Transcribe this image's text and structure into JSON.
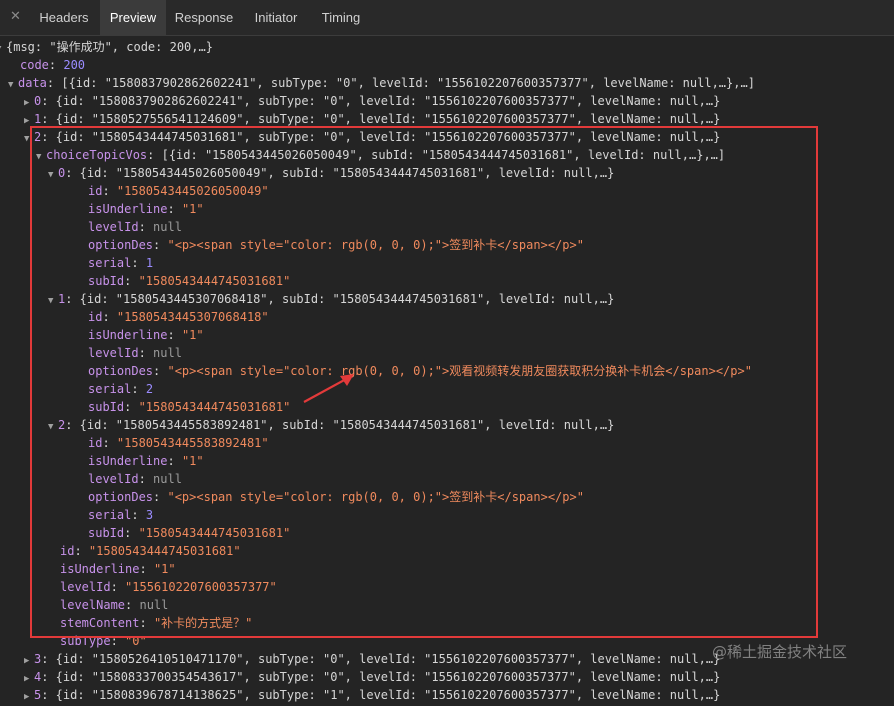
{
  "tabs": {
    "close": "✕",
    "headers": "Headers",
    "preview": "Preview",
    "response": "Response",
    "initiator": "Initiator",
    "timing": "Timing"
  },
  "rows": [
    {
      "id": "r0",
      "t": "▼",
      "parts": [
        [
          "p",
          "{msg: \"操作成功\", code: 200,…}"
        ]
      ]
    },
    {
      "id": "r1",
      "t": "",
      "parts": [
        [
          "k",
          "code"
        ],
        [
          "p",
          ": "
        ],
        [
          "n",
          "200"
        ]
      ]
    },
    {
      "id": "r2",
      "t": "▼",
      "parts": [
        [
          "k",
          "data"
        ],
        [
          "p",
          ": [{id: \"1580837902862602241\", subType: \"0\", levelId: \"1556102207600357377\", levelName: null,…},…]"
        ]
      ]
    },
    {
      "id": "r3",
      "t": "▶",
      "parts": [
        [
          "k",
          "0"
        ],
        [
          "p",
          ": {id: \"1580837902862602241\", subType: \"0\", levelId: \"1556102207600357377\", levelName: null,…}"
        ]
      ]
    },
    {
      "id": "r4",
      "t": "▶",
      "parts": [
        [
          "k",
          "1"
        ],
        [
          "p",
          ": {id: \"1580527556541124609\", subType: \"0\", levelId: \"1556102207600357377\", levelName: null,…}"
        ]
      ]
    },
    {
      "id": "r5",
      "t": "▼",
      "parts": [
        [
          "k",
          "2"
        ],
        [
          "p",
          ": {id: \"1580543444745031681\", subType: \"0\", levelId: \"1556102207600357377\", levelName: null,…}"
        ]
      ]
    },
    {
      "id": "r6",
      "t": "▼",
      "parts": [
        [
          "k",
          "choiceTopicVos"
        ],
        [
          "p",
          ": [{id: \"1580543445026050049\", subId: \"1580543444745031681\", levelId: null,…},…]"
        ]
      ]
    },
    {
      "id": "r7",
      "t": "▼",
      "parts": [
        [
          "k",
          "0"
        ],
        [
          "p",
          ": {id: \"1580543445026050049\", subId: \"1580543444745031681\", levelId: null,…}"
        ]
      ]
    },
    {
      "id": "r8",
      "t": "",
      "parts": [
        [
          "k",
          "id"
        ],
        [
          "p",
          ": "
        ],
        [
          "s",
          "\"1580543445026050049\""
        ]
      ]
    },
    {
      "id": "r9",
      "t": "",
      "parts": [
        [
          "k",
          "isUnderline"
        ],
        [
          "p",
          ": "
        ],
        [
          "s",
          "\"1\""
        ]
      ]
    },
    {
      "id": "r10",
      "t": "",
      "parts": [
        [
          "k",
          "levelId"
        ],
        [
          "p",
          ": "
        ],
        [
          "nl",
          "null"
        ]
      ]
    },
    {
      "id": "r11",
      "t": "",
      "parts": [
        [
          "k",
          "optionDes"
        ],
        [
          "p",
          ": "
        ],
        [
          "s",
          "\"<p><span style=\"color: rgb(0, 0, 0);\">签到补卡</span></p>\""
        ]
      ]
    },
    {
      "id": "r12",
      "t": "",
      "parts": [
        [
          "k",
          "serial"
        ],
        [
          "p",
          ": "
        ],
        [
          "n",
          "1"
        ]
      ]
    },
    {
      "id": "r13",
      "t": "",
      "parts": [
        [
          "k",
          "subId"
        ],
        [
          "p",
          ": "
        ],
        [
          "s",
          "\"1580543444745031681\""
        ]
      ]
    },
    {
      "id": "r14",
      "t": "▼",
      "parts": [
        [
          "k",
          "1"
        ],
        [
          "p",
          ": {id: \"1580543445307068418\", subId: \"1580543444745031681\", levelId: null,…}"
        ]
      ]
    },
    {
      "id": "r15",
      "t": "",
      "parts": [
        [
          "k",
          "id"
        ],
        [
          "p",
          ": "
        ],
        [
          "s",
          "\"1580543445307068418\""
        ]
      ]
    },
    {
      "id": "r16",
      "t": "",
      "parts": [
        [
          "k",
          "isUnderline"
        ],
        [
          "p",
          ": "
        ],
        [
          "s",
          "\"1\""
        ]
      ]
    },
    {
      "id": "r17",
      "t": "",
      "parts": [
        [
          "k",
          "levelId"
        ],
        [
          "p",
          ": "
        ],
        [
          "nl",
          "null"
        ]
      ]
    },
    {
      "id": "r18",
      "t": "",
      "parts": [
        [
          "k",
          "optionDes"
        ],
        [
          "p",
          ": "
        ],
        [
          "s",
          "\"<p><span style=\"color: rgb(0, 0, 0);\">观看视频转发朋友圈获取积分换补卡机会</span></p>\""
        ]
      ]
    },
    {
      "id": "r19",
      "t": "",
      "parts": [
        [
          "k",
          "serial"
        ],
        [
          "p",
          ": "
        ],
        [
          "n",
          "2"
        ]
      ]
    },
    {
      "id": "r20",
      "t": "",
      "parts": [
        [
          "k",
          "subId"
        ],
        [
          "p",
          ": "
        ],
        [
          "s",
          "\"1580543444745031681\""
        ]
      ]
    },
    {
      "id": "r21",
      "t": "▼",
      "parts": [
        [
          "k",
          "2"
        ],
        [
          "p",
          ": {id: \"1580543445583892481\", subId: \"1580543444745031681\", levelId: null,…}"
        ]
      ]
    },
    {
      "id": "r22",
      "t": "",
      "parts": [
        [
          "k",
          "id"
        ],
        [
          "p",
          ": "
        ],
        [
          "s",
          "\"1580543445583892481\""
        ]
      ]
    },
    {
      "id": "r23",
      "t": "",
      "parts": [
        [
          "k",
          "isUnderline"
        ],
        [
          "p",
          ": "
        ],
        [
          "s",
          "\"1\""
        ]
      ]
    },
    {
      "id": "r24",
      "t": "",
      "parts": [
        [
          "k",
          "levelId"
        ],
        [
          "p",
          ": "
        ],
        [
          "nl",
          "null"
        ]
      ]
    },
    {
      "id": "r25",
      "t": "",
      "parts": [
        [
          "k",
          "optionDes"
        ],
        [
          "p",
          ": "
        ],
        [
          "s",
          "\"<p><span style=\"color: rgb(0, 0, 0);\">签到补卡</span></p>\""
        ]
      ]
    },
    {
      "id": "r26",
      "t": "",
      "parts": [
        [
          "k",
          "serial"
        ],
        [
          "p",
          ": "
        ],
        [
          "n",
          "3"
        ]
      ]
    },
    {
      "id": "r27",
      "t": "",
      "parts": [
        [
          "k",
          "subId"
        ],
        [
          "p",
          ": "
        ],
        [
          "s",
          "\"1580543444745031681\""
        ]
      ]
    },
    {
      "id": "r28",
      "t": "",
      "parts": [
        [
          "k",
          "id"
        ],
        [
          "p",
          ": "
        ],
        [
          "s",
          "\"1580543444745031681\""
        ]
      ]
    },
    {
      "id": "r29",
      "t": "",
      "parts": [
        [
          "k",
          "isUnderline"
        ],
        [
          "p",
          ": "
        ],
        [
          "s",
          "\"1\""
        ]
      ]
    },
    {
      "id": "r30",
      "t": "",
      "parts": [
        [
          "k",
          "levelId"
        ],
        [
          "p",
          ": "
        ],
        [
          "s",
          "\"1556102207600357377\""
        ]
      ]
    },
    {
      "id": "r31",
      "t": "",
      "parts": [
        [
          "k",
          "levelName"
        ],
        [
          "p",
          ": "
        ],
        [
          "nl",
          "null"
        ]
      ]
    },
    {
      "id": "r32",
      "t": "",
      "parts": [
        [
          "k",
          "stemContent"
        ],
        [
          "p",
          ": "
        ],
        [
          "s",
          "\"补卡的方式是？\""
        ]
      ]
    },
    {
      "id": "r33",
      "t": "",
      "parts": [
        [
          "k",
          "subType"
        ],
        [
          "p",
          ": "
        ],
        [
          "s",
          "\"0\""
        ]
      ]
    },
    {
      "id": "r34",
      "t": "▶",
      "parts": [
        [
          "k",
          "3"
        ],
        [
          "p",
          ": {id: \"1580526410510471170\", subType: \"0\", levelId: \"1556102207600357377\", levelName: null,…}"
        ]
      ]
    },
    {
      "id": "r35",
      "t": "▶",
      "parts": [
        [
          "k",
          "4"
        ],
        [
          "p",
          ": {id: \"1580833700354543617\", subType: \"0\", levelId: \"1556102207600357377\", levelName: null,…}"
        ]
      ]
    },
    {
      "id": "r36",
      "t": "▶",
      "parts": [
        [
          "k",
          "5"
        ],
        [
          "p",
          ": {id: \"1580839678714138625\", subType: \"1\", levelId: \"1556102207600357377\", levelName: null,…}"
        ]
      ]
    }
  ],
  "watermark": "@稀土掘金技术社区"
}
